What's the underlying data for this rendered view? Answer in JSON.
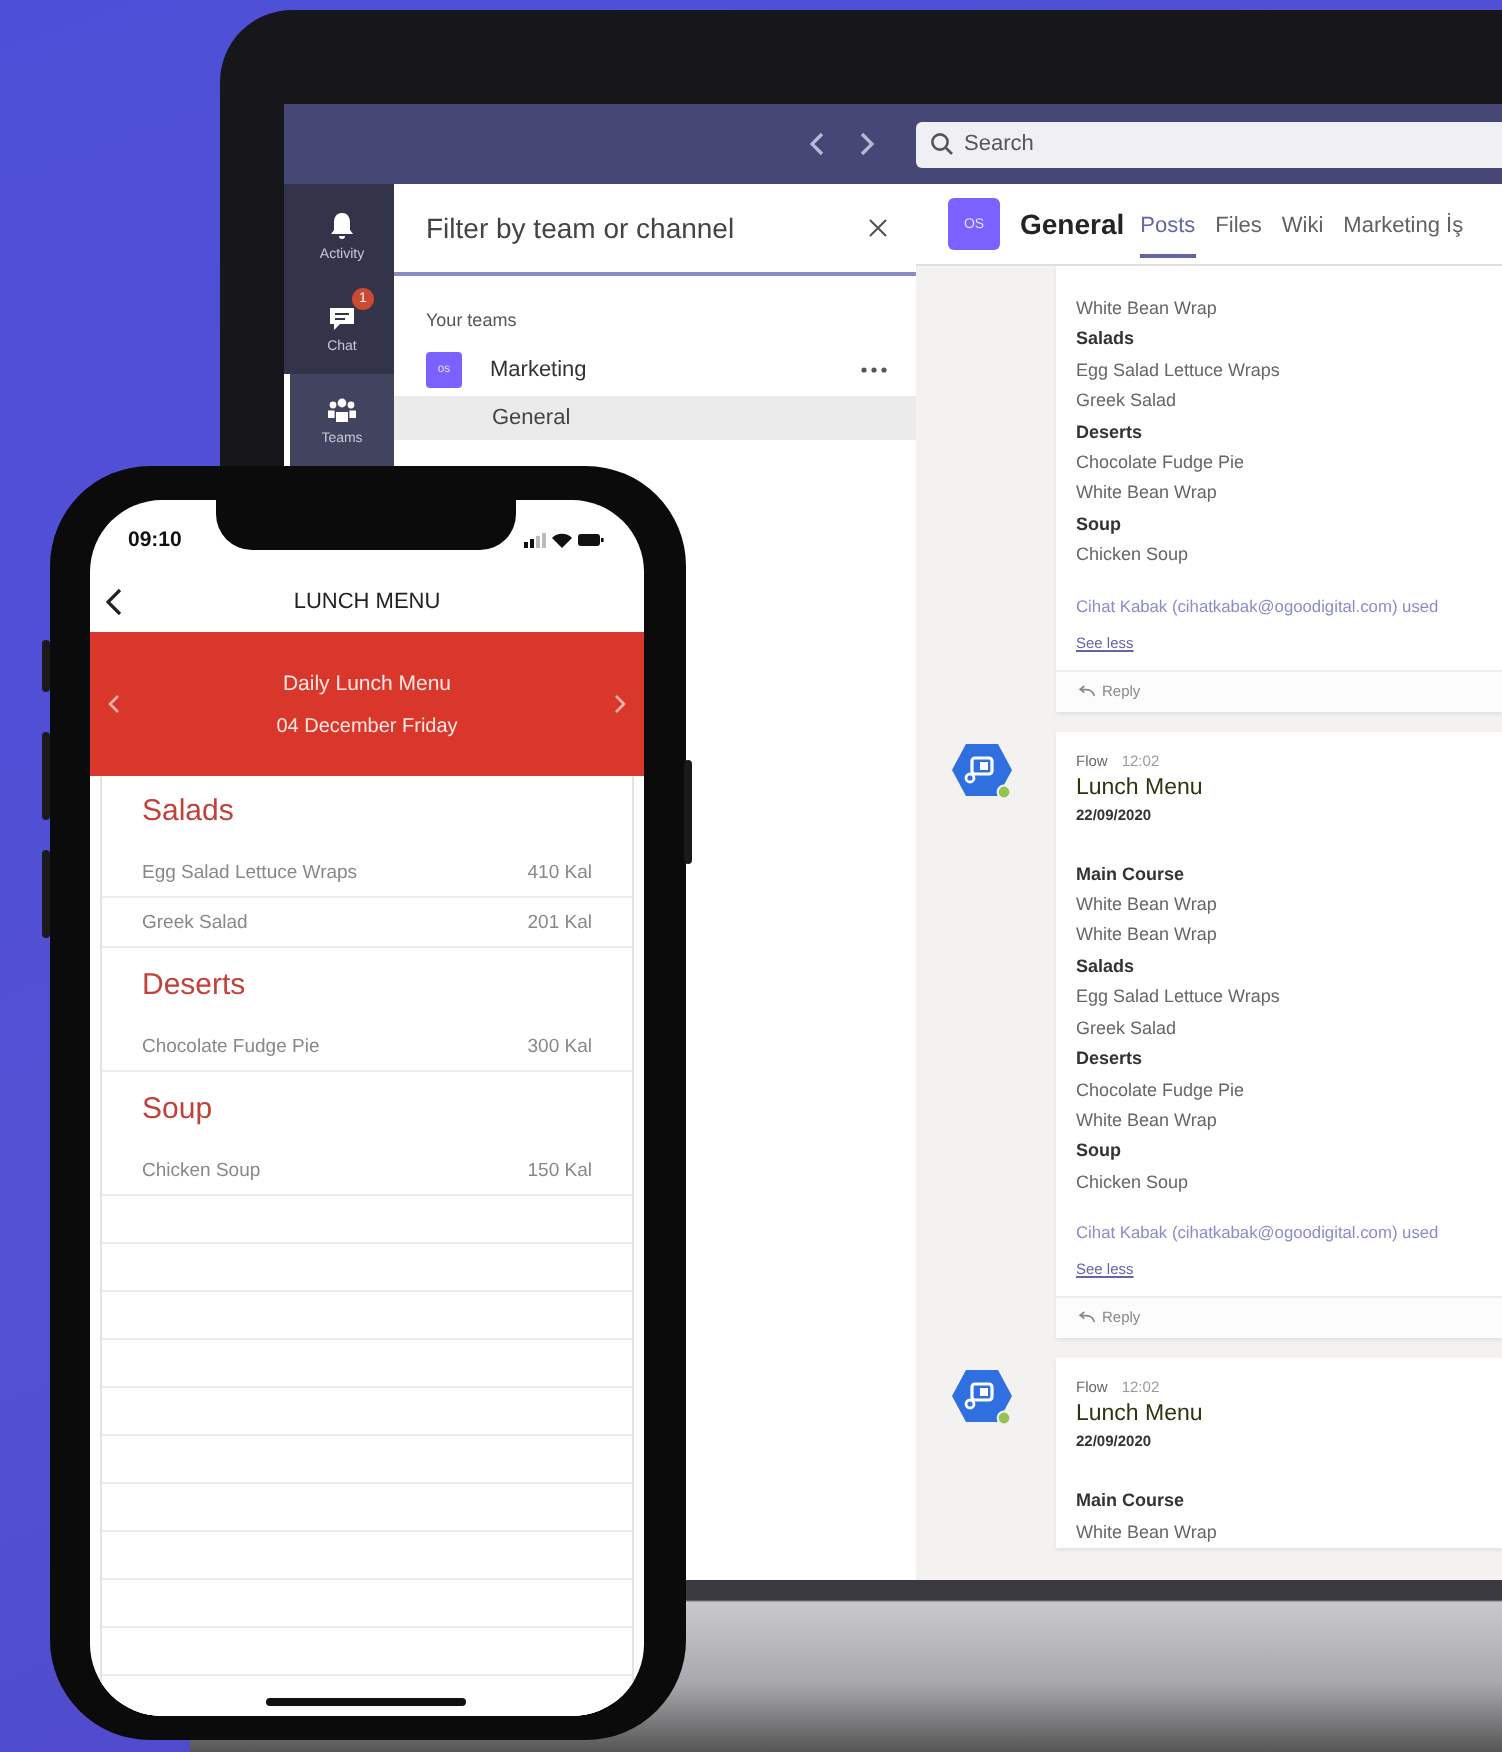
{
  "teams": {
    "search": {
      "placeholder": "Search"
    },
    "rail": [
      {
        "label": "Activity",
        "selected": false
      },
      {
        "label": "Chat",
        "badge": "1",
        "selected": false
      },
      {
        "label": "Teams",
        "selected": true
      }
    ],
    "filter": {
      "placeholder": "Filter by team or channel"
    },
    "teams_heading": "Your teams",
    "team_list": [
      {
        "avatar": "os",
        "name": "Marketing",
        "children": [
          {
            "name": "General",
            "selected": true
          }
        ]
      }
    ],
    "channel_header": {
      "avatar": "OS",
      "title": "General",
      "tabs": [
        {
          "label": "Posts",
          "selected": true
        },
        {
          "label": "Files",
          "selected": false
        },
        {
          "label": "Wiki",
          "selected": false
        },
        {
          "label": "Marketing İş",
          "selected": false
        }
      ]
    },
    "posts": [
      {
        "kind": "continued",
        "lines": [
          {
            "kind": "item",
            "text": "White Bean Wrap"
          },
          {
            "kind": "heading",
            "text": "Salads"
          },
          {
            "kind": "item",
            "text": "Egg Salad Lettuce Wraps"
          },
          {
            "kind": "item",
            "text": "Greek Salad"
          },
          {
            "kind": "heading",
            "text": "Deserts"
          },
          {
            "kind": "item",
            "text": "Chocolate Fudge Pie"
          },
          {
            "kind": "item",
            "text": "White Bean Wrap"
          },
          {
            "kind": "heading",
            "text": "Soup"
          },
          {
            "kind": "item",
            "text": "Chicken Soup"
          }
        ],
        "footer": "Cihat Kabak (cihatkabak@ogoodigital.com) used",
        "see_less": "See less",
        "reply": "Reply"
      },
      {
        "kind": "message",
        "author": "Flow",
        "time": "12:02",
        "title": "Lunch Menu",
        "date": "22/09/2020",
        "lines": [
          {
            "kind": "heading",
            "text": "Main Course"
          },
          {
            "kind": "item",
            "text": "White Bean Wrap"
          },
          {
            "kind": "item",
            "text": "White Bean Wrap"
          },
          {
            "kind": "heading",
            "text": "Salads"
          },
          {
            "kind": "item",
            "text": "Egg Salad Lettuce Wraps"
          },
          {
            "kind": "item",
            "text": "Greek Salad"
          },
          {
            "kind": "heading",
            "text": "Deserts"
          },
          {
            "kind": "item",
            "text": "Chocolate Fudge Pie"
          },
          {
            "kind": "item",
            "text": "White Bean Wrap"
          },
          {
            "kind": "heading",
            "text": "Soup"
          },
          {
            "kind": "item",
            "text": "Chicken Soup"
          }
        ],
        "footer": "Cihat Kabak (cihatkabak@ogoodigital.com) used",
        "see_less": "See less",
        "reply": "Reply"
      },
      {
        "kind": "message",
        "author": "Flow",
        "time": "12:02",
        "title": "Lunch Menu",
        "date": "22/09/2020",
        "lines": [
          {
            "kind": "heading",
            "text": "Main Course"
          },
          {
            "kind": "item",
            "text": "White Bean Wrap"
          }
        ]
      }
    ]
  },
  "phone": {
    "time": "09:10",
    "title": "LUNCH MENU",
    "banner": {
      "title": "Daily Lunch Menu",
      "date": "04 December Friday"
    },
    "sections": [
      {
        "heading": "Salads",
        "items": [
          {
            "name": "Egg Salad Lettuce Wraps",
            "calories": "410 Kal"
          },
          {
            "name": "Greek Salad",
            "calories": "201 Kal"
          }
        ]
      },
      {
        "heading": "Deserts",
        "items": [
          {
            "name": "Chocolate Fudge Pie",
            "calories": "300 Kal"
          }
        ]
      },
      {
        "heading": "Soup",
        "items": [
          {
            "name": "Chicken Soup",
            "calories": "150 Kal"
          }
        ]
      }
    ]
  }
}
